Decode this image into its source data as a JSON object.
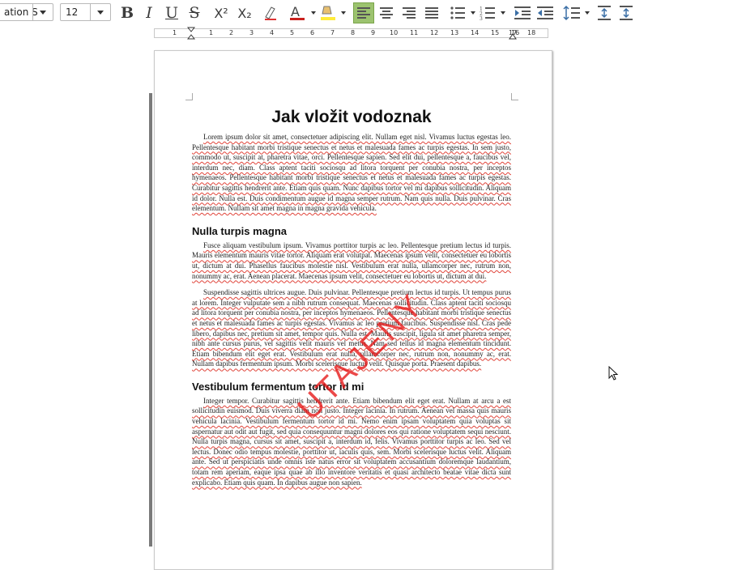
{
  "toolbar": {
    "font_name": "ation S",
    "font_size": "12",
    "bold": "B",
    "italic": "I",
    "underline": "U",
    "strikethrough": "S",
    "superscript": "X²",
    "subscript": "X₂"
  },
  "ruler": {
    "marks": [
      "1",
      "1",
      "2",
      "3",
      "4",
      "5",
      "6",
      "7",
      "8",
      "9",
      "10",
      "11",
      "12",
      "13",
      "14",
      "15",
      "16",
      "17",
      "18"
    ]
  },
  "document": {
    "title": "Jak vložit vodoznak",
    "watermark": "UTAJENY",
    "paragraphs": {
      "p1": "Lorem ipsum dolor sit amet, consectetuer adipiscing elit. Nullam eget nisl. Vivamus luctus egestas leo. Pellentesque habitant morbi tristique senectus et netus et malesuada fames ac turpis egestas. In sem justo, commodo ut, suscipit at, pharetra vitae, orci. Pellentesque sapien. Sed elit dui, pellentesque a, faucibus vel, interdum nec, diam. Class aptent taciti sociosqu ad litora torquent per conubia nostra, per inceptos hymenaeos. Pellentesque habitant morbi tristique senectus et netus et malesuada fames ac turpis egestas. Curabitur sagittis hendrerit ante. Etiam quis quam. Nunc dapibus tortor vel mi dapibus sollicitudin. Aliquam id dolor. Nulla est. Duis condimentum augue id magna semper rutrum. Nam quis nulla. Duis pulvinar. Cras elementum. Nullam sit amet magna in magna gravida vehicula.",
      "h2a": "Nulla turpis magna",
      "p2": "Fusce aliquam vestibulum ipsum. Vivamus porttitor turpis ac leo. Pellentesque pretium lectus id turpis. Mauris elementum mauris vitae tortor. Aliquam erat volutpat. Maecenas ipsum velit, consectetuer eu lobortis ut, dictum at dui. Phasellus faucibus molestie nisl. Vestibulum erat nulla, ullamcorper nec, rutrum non, nonummy ac, erat. Aenean placerat. Maecenas ipsum velit, consectetuer eu lobortis ut, dictum at dui.",
      "p3": "Suspendisse sagittis ultrices augue. Duis pulvinar. Pellentesque pretium lectus id turpis. Ut tempus purus at lorem. Integer vulputate sem a nibh rutrum consequat. Maecenas sollicitudin. Class aptent taciti sociosqu ad litora torquent per conubia nostra, per inceptos hymenaeos. Pellentesque habitant morbi tristique senectus et netus et malesuada fames ac turpis egestas. Vivamus ac leo pretium faucibus. Suspendisse nisl. Cras pede libero, dapibus nec, pretium sit amet, tempor quis. Nulla est. Mauris suscipit, ligula sit amet pharetra semper, nibh ante cursus purus, vel sagittis velit mauris vel metus. Nam sed tellus id magna elementum tincidunt. Etiam bibendum elit eget erat. Vestibulum erat nulla, ullamcorper nec, rutrum non, nonummy ac, erat. Nullam dapibus fermentum ipsum. Morbi scelerisque luctus velit. Quisque porta. Praesent dapibus.",
      "h2b": "Vestibulum fermentum tortor id mi",
      "p4": "Integer tempor. Curabitur sagittis hendrerit ante. Etiam bibendum elit eget erat. Nullam at arcu a est sollicitudin euismod. Duis viverra diam non justo. Integer lacinia. In rutrum. Aenean vel massa quis mauris vehicula lacinia. Vestibulum fermentum tortor id mi. Nemo enim ipsam voluptatem quia voluptas sit aspernatur aut odit aut fugit, sed quia consequuntur magni dolores eos qui ratione voluptatem sequi nesciunt. Nulla turpis magna, cursus sit amet, suscipit a, interdum id, felis. Vivamus porttitor turpis ac leo. Sed vel lectus. Donec odio tempus molestie, porttitor ut, iaculis quis, sem. Morbi scelerisque luctus velit. Aliquam ante. Sed ut perspiciatis unde omnis iste natus error sit voluptatem accusantium doloremque laudantium, totam rem aperiam, eaque ipsa quae ab illo inventore veritatis et quasi architecto beatae vitae dicta sunt explicabo. Etiam quis quam. In dapibus augue non sapien."
    }
  }
}
